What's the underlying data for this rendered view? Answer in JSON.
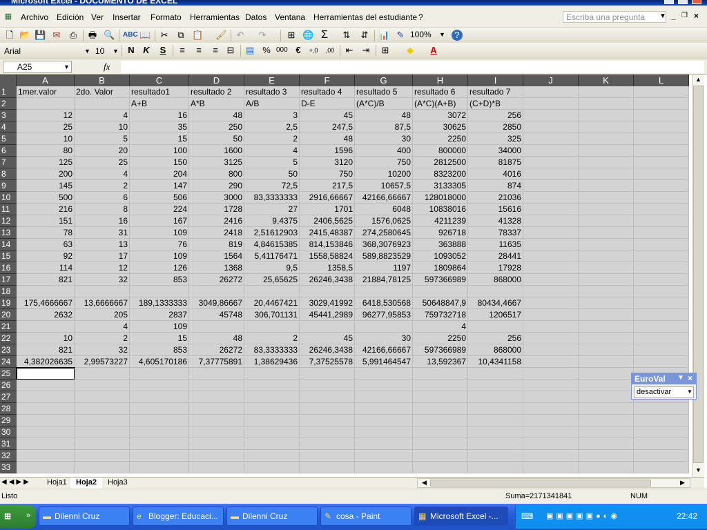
{
  "window": {
    "title": "Microsoft Excel - DOCUMENTO DE EXCEL"
  },
  "menu": [
    "Archivo",
    "Edición",
    "Ver",
    "Insertar",
    "Formato",
    "Herramientas",
    "Datos",
    "Ventana",
    "Herramientas del estudiante",
    "?"
  ],
  "ask_placeholder": "Escriba una pregunta",
  "toolbar": {
    "zoom": "100%",
    "font": "Arial",
    "size": "10",
    "bold": "N",
    "italic": "K",
    "underline": "S",
    "currency": "€",
    "percent": "%",
    "thousands": "000",
    "sum": "Σ"
  },
  "formula": {
    "namebox": "A25",
    "fx": "fx",
    "content": ""
  },
  "columns": [
    "A",
    "B",
    "C",
    "D",
    "E",
    "F",
    "G",
    "H",
    "I",
    "J",
    "K",
    "L"
  ],
  "rows": [
    [
      "1mer.valor",
      "2do. Valor",
      "resultado1",
      "resultado 2",
      "resultado 3",
      "resultado 4",
      "resultado 5",
      "resultado 6",
      "resultado 7"
    ],
    [
      "",
      "",
      "A+B",
      "A*B",
      "A/B",
      "D-E",
      "(A*C)/B",
      "(A*C)(A+B)",
      "(C+D)*B"
    ],
    [
      "12",
      "4",
      "16",
      "48",
      "3",
      "45",
      "48",
      "3072",
      "256"
    ],
    [
      "25",
      "10",
      "35",
      "250",
      "2,5",
      "247,5",
      "87,5",
      "30625",
      "2850"
    ],
    [
      "10",
      "5",
      "15",
      "50",
      "2",
      "48",
      "30",
      "2250",
      "325"
    ],
    [
      "80",
      "20",
      "100",
      "1600",
      "4",
      "1596",
      "400",
      "800000",
      "34000"
    ],
    [
      "125",
      "25",
      "150",
      "3125",
      "5",
      "3120",
      "750",
      "2812500",
      "81875"
    ],
    [
      "200",
      "4",
      "204",
      "800",
      "50",
      "750",
      "10200",
      "8323200",
      "4016"
    ],
    [
      "145",
      "2",
      "147",
      "290",
      "72,5",
      "217,5",
      "10657,5",
      "3133305",
      "874"
    ],
    [
      "500",
      "6",
      "506",
      "3000",
      "83,3333333",
      "2916,66667",
      "42166,66667",
      "128018000",
      "21036"
    ],
    [
      "216",
      "8",
      "224",
      "1728",
      "27",
      "1701",
      "6048",
      "10838016",
      "15616"
    ],
    [
      "151",
      "16",
      "167",
      "2416",
      "9,4375",
      "2406,5625",
      "1576,0625",
      "4211239",
      "41328"
    ],
    [
      "78",
      "31",
      "109",
      "2418",
      "2,51612903",
      "2415,48387",
      "274,2580645",
      "926718",
      "78337"
    ],
    [
      "63",
      "13",
      "76",
      "819",
      "4,84615385",
      "814,153846",
      "368,3076923",
      "363888",
      "11635"
    ],
    [
      "92",
      "17",
      "109",
      "1564",
      "5,41176471",
      "1558,58824",
      "589,8823529",
      "1093052",
      "28441"
    ],
    [
      "114",
      "12",
      "126",
      "1368",
      "9,5",
      "1358,5",
      "1197",
      "1809864",
      "17928"
    ],
    [
      "821",
      "32",
      "853",
      "26272",
      "25,65625",
      "26246,3438",
      "21884,78125",
      "597366989",
      "868000"
    ],
    [
      "",
      "",
      "",
      "",
      "",
      "",
      "",
      "",
      ""
    ],
    [
      "175,4666667",
      "13,6666667",
      "189,1333333",
      "3049,86667",
      "20,4467421",
      "3029,41992",
      "6418,530568",
      "50648847,9",
      "80434,4667"
    ],
    [
      "2632",
      "205",
      "2837",
      "45748",
      "306,701131",
      "45441,2989",
      "96277,95853",
      "759732718",
      "1206517"
    ],
    [
      "",
      "4",
      "109",
      "",
      "",
      "",
      "",
      "4",
      ""
    ],
    [
      "10",
      "2",
      "15",
      "48",
      "2",
      "45",
      "30",
      "2250",
      "256"
    ],
    [
      "821",
      "32",
      "853",
      "26272",
      "83,3333333",
      "26246,3438",
      "42166,66667",
      "597366989",
      "868000"
    ],
    [
      "4,382026635",
      "2,99573227",
      "4,605170186",
      "7,37775891",
      "1,38629436",
      "7,37525578",
      "5,991464547",
      "13,592367",
      "10,4341158"
    ]
  ],
  "row_count": 33,
  "sheets": [
    "Hoja1",
    "Hoja2",
    "Hoja3"
  ],
  "active_sheet": "Hoja2",
  "status": {
    "left": "Listo",
    "sum": "Suma=2171341841",
    "num": "NUM"
  },
  "euro": {
    "title": "EuroVal",
    "value": "desactivar"
  },
  "taskbar": {
    "start": "Inicio",
    "items": [
      "Dilenni Cruz",
      "Blogger: Educaci...",
      "Dilenni Cruz",
      "cosa - Paint",
      "Microsoft Excel -..."
    ],
    "clock": "22:42"
  }
}
